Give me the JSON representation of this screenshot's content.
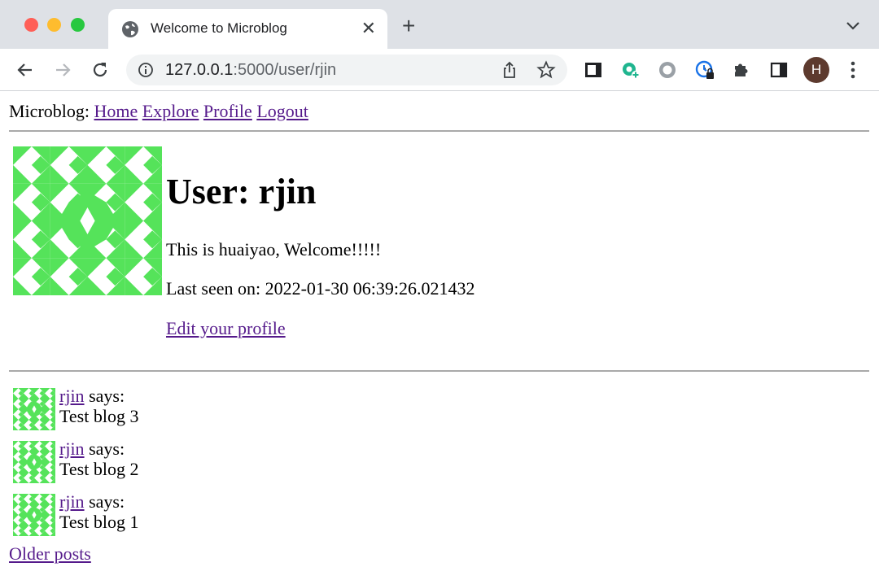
{
  "browser": {
    "tab_title": "Welcome to Microblog",
    "url_host": "127.0.0.1",
    "url_rest": ":5000/user/rjin",
    "profile_initial": "H"
  },
  "nav": {
    "brand": "Microblog:",
    "links": [
      "Home",
      "Explore",
      "Profile",
      "Logout"
    ]
  },
  "profile": {
    "title": "User: rjin",
    "about_me": "This is huaiyao, Welcome!!!!!",
    "last_seen": "Last seen on: 2022-01-30 06:39:26.021432",
    "edit_link": "Edit your profile"
  },
  "posts": [
    {
      "author": "rjin",
      "says": "says:",
      "body": "Test blog 3"
    },
    {
      "author": "rjin",
      "says": "says:",
      "body": "Test blog 2"
    },
    {
      "author": "rjin",
      "says": "says:",
      "body": "Test blog 1"
    }
  ],
  "pagination": {
    "older": "Older posts"
  },
  "colors": {
    "identicon": "#55e35a",
    "link": "#551a8b"
  }
}
